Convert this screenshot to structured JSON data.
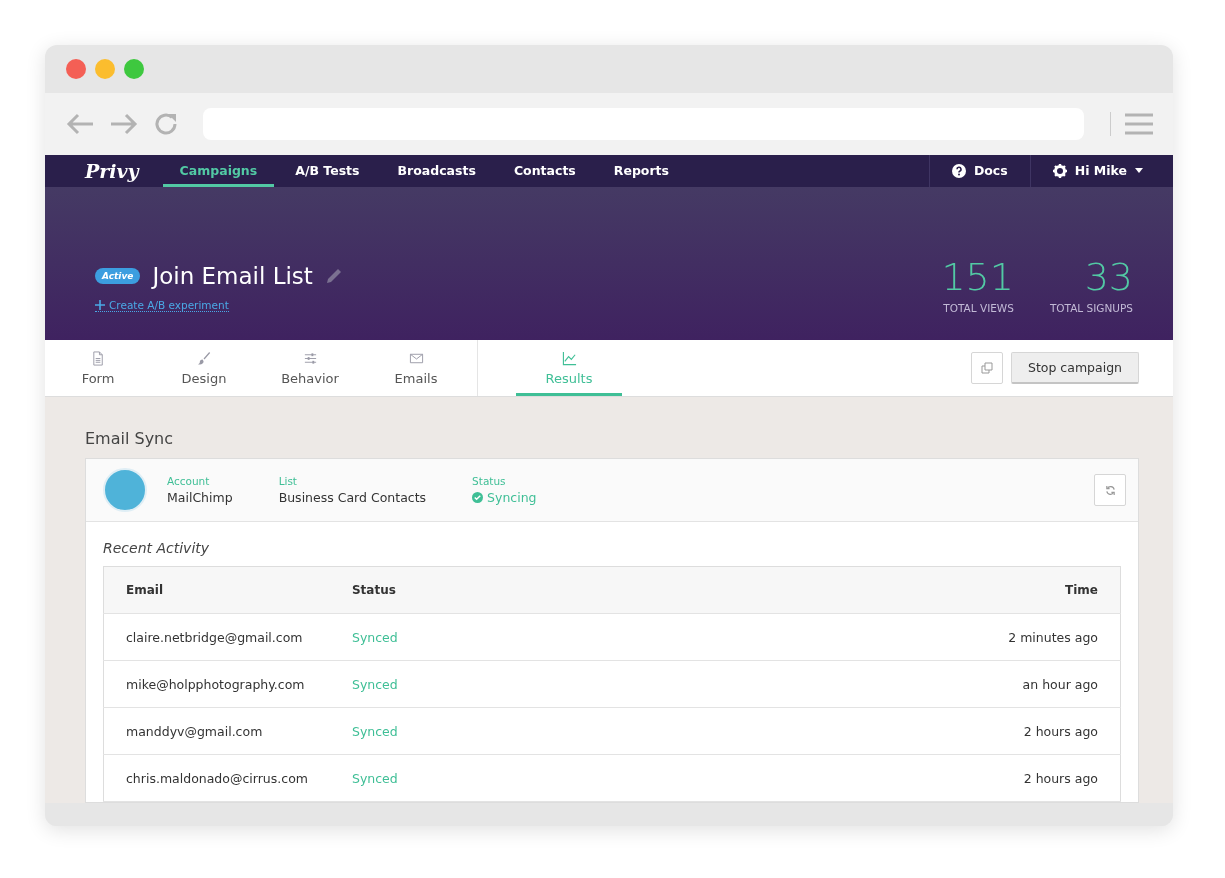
{
  "nav": {
    "logo": "Privy",
    "items": [
      {
        "label": "Campaigns",
        "selected": true
      },
      {
        "label": "A/B Tests",
        "selected": false
      },
      {
        "label": "Broadcasts",
        "selected": false
      },
      {
        "label": "Contacts",
        "selected": false
      },
      {
        "label": "Reports",
        "selected": false
      }
    ],
    "docs": "Docs",
    "user": "Hi Mike"
  },
  "campaign": {
    "status": "Active",
    "title": "Join Email List",
    "ab_link": "Create A/B experiment",
    "stats": [
      {
        "value": "151",
        "label": "TOTAL VIEWS"
      },
      {
        "value": "33",
        "label": "TOTAL SIGNUPS"
      }
    ]
  },
  "tabs": [
    {
      "label": "Form",
      "selected": false
    },
    {
      "label": "Design",
      "selected": false
    },
    {
      "label": "Behavior",
      "selected": false
    },
    {
      "label": "Emails",
      "selected": false
    },
    {
      "label": "Results",
      "selected": true
    }
  ],
  "stop_button": "Stop campaign",
  "email_sync": {
    "title": "Email Sync",
    "fields": [
      {
        "label": "Account",
        "value": "MailChimp"
      },
      {
        "label": "List",
        "value": "Business Card Contacts"
      },
      {
        "label": "Status",
        "value": "Syncing"
      }
    ],
    "activity_title": "Recent Activity",
    "columns": [
      "Email",
      "Status",
      "Time"
    ],
    "rows": [
      {
        "email": "claire.netbridge@gmail.com",
        "status": "Synced",
        "time": "2 minutes ago"
      },
      {
        "email": "mike@holpphotography.com",
        "status": "Synced",
        "time": "an hour ago"
      },
      {
        "email": "manddyv@gmail.com",
        "status": "Synced",
        "time": "2 hours ago"
      },
      {
        "email": "chris.maldonado@cirrus.com",
        "status": "Synced",
        "time": "2 hours ago"
      }
    ]
  }
}
